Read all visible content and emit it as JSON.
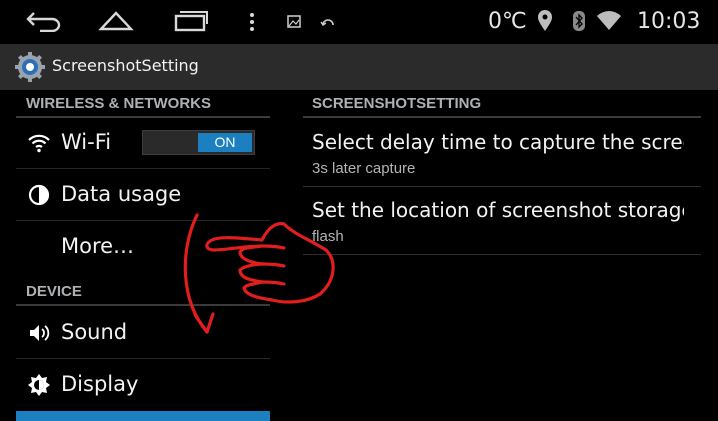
{
  "status_bar": {
    "icons": [
      "back-icon",
      "home-icon",
      "recent-apps-icon",
      "menu-dots-icon",
      "gallery-icon",
      "refresh-icon",
      "location-icon",
      "bluetooth-icon",
      "wifi-signal-icon"
    ],
    "temperature": "0℃",
    "time": "10:03"
  },
  "action_bar": {
    "title": "ScreenshotSetting",
    "icon": "gear-icon"
  },
  "sidebar": {
    "sections": [
      {
        "header": "WIRELESS & NETWORKS",
        "items": [
          {
            "label": "Wi-Fi",
            "icon": "wifi-icon",
            "toggle": "ON"
          },
          {
            "label": "Data usage",
            "icon": "data-usage-icon"
          },
          {
            "label": "More…"
          }
        ]
      },
      {
        "header": "DEVICE",
        "items": [
          {
            "label": "Sound",
            "icon": "speaker-icon"
          },
          {
            "label": "Display",
            "icon": "brightness-icon"
          }
        ]
      }
    ]
  },
  "main": {
    "header": "SCREENSHOTSETTING",
    "items": [
      {
        "title": "Select delay time to capture the screen",
        "subtitle": "3s later capture"
      },
      {
        "title": "Set the location of screenshot storage",
        "subtitle": "flash"
      }
    ]
  },
  "colors": {
    "accent": "#1c7fbf",
    "annotation": "#e01e1e"
  }
}
